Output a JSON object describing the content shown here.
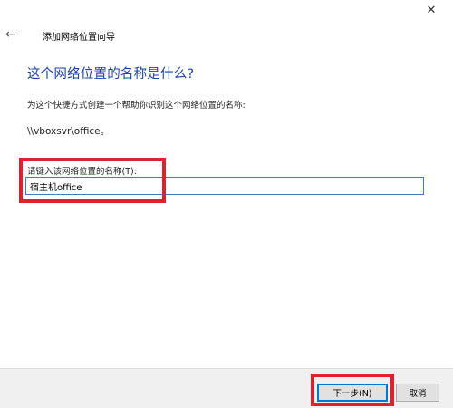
{
  "window": {
    "close_glyph": "✕"
  },
  "header": {
    "back_glyph": "←",
    "title": "添加网络位置向导"
  },
  "main": {
    "heading": "这个网络位置的名称是什么?",
    "instruction": "为这个快捷方式创建一个帮助你识别这个网络位置的名称:",
    "unc_path": "\\\\vboxsvr\\office。",
    "field_label": "请键入该网络位置的名称(T):",
    "field_value": "宿主机office"
  },
  "footer": {
    "next_label": "下一步(N)",
    "cancel_label": "取消"
  },
  "colors": {
    "heading_blue": "#1a3fa6",
    "annotation_red": "#e0202a",
    "input_border": "#3e7bc4"
  },
  "icons": [
    "close-icon",
    "back-arrow-icon"
  ]
}
